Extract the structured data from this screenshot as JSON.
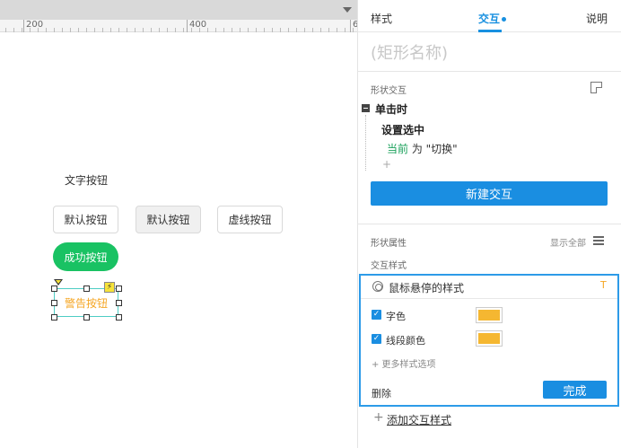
{
  "ruler": {
    "labels": [
      "200",
      "400",
      "6"
    ]
  },
  "canvas": {
    "text_button_label": "文字按钮",
    "buttons": {
      "default": "默认按钮",
      "default_gray": "默认按钮",
      "dashed": "虚线按钮",
      "success": "成功按钮",
      "warning": "警告按钮"
    },
    "colors": {
      "success": "#19c263",
      "warning": "#f5a623",
      "selection": "#4ecdc4"
    }
  },
  "panel": {
    "tabs": {
      "style": "样式",
      "interaction": "交互",
      "notes": "说明"
    },
    "shape_name_placeholder": "(矩形名称)",
    "shape_interaction": {
      "section_label": "形状交互",
      "event": "单击时",
      "action": "设置选中",
      "target": "当前",
      "target_rest": " 为 \"切换\"",
      "add_symbol": "+",
      "new_interaction_button": "新建交互"
    },
    "shape_properties": {
      "section_label": "形状属性",
      "show_all": "显示全部",
      "interaction_style_label": "交互样式"
    },
    "hover_style": {
      "title": "鼠标悬停的样式",
      "corner_mark": "T",
      "options": [
        {
          "label": "字色",
          "checked": true,
          "color": "#f5b731"
        },
        {
          "label": "线段颜色",
          "checked": true,
          "color": "#f5b731"
        }
      ],
      "more_options": "+ 更多样式选项",
      "delete_label": "删除",
      "done_button": "完成"
    },
    "add_interaction_style": "添加交互样式",
    "accent_color": "#1a8ee1"
  }
}
